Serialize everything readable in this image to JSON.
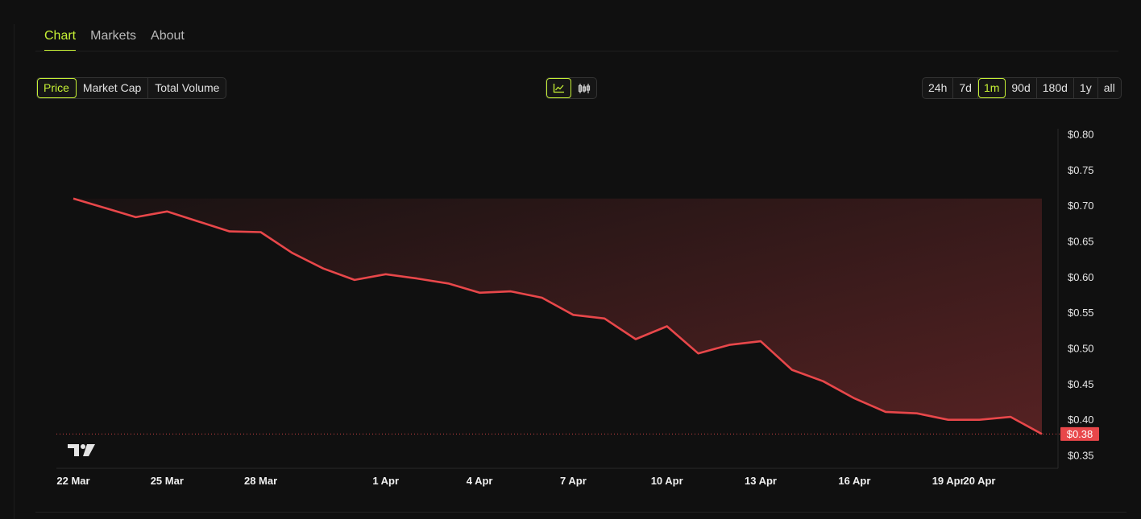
{
  "tabs": [
    {
      "label": "Chart",
      "active": true
    },
    {
      "label": "Markets",
      "active": false
    },
    {
      "label": "About",
      "active": false
    }
  ],
  "metric_options": [
    {
      "label": "Price",
      "active": true
    },
    {
      "label": "Market Cap",
      "active": false
    },
    {
      "label": "Total Volume",
      "active": false
    }
  ],
  "chart_type_options": [
    {
      "icon": "line-chart-icon",
      "active": true
    },
    {
      "icon": "candlestick-icon",
      "active": false
    }
  ],
  "range_options": [
    {
      "label": "24h",
      "active": false
    },
    {
      "label": "7d",
      "active": false
    },
    {
      "label": "1m",
      "active": true
    },
    {
      "label": "90d",
      "active": false
    },
    {
      "label": "180d",
      "active": false
    },
    {
      "label": "1y",
      "active": false
    },
    {
      "label": "all",
      "active": false
    }
  ],
  "colors": {
    "accent": "#c6f135",
    "line": "#e8474a",
    "price_tag_bg": "#e8474a"
  },
  "chart_data": {
    "type": "area",
    "x_ticks": [
      "22 Mar",
      "25 Mar",
      "28 Mar",
      "1 Apr",
      "4 Apr",
      "7 Apr",
      "10 Apr",
      "13 Apr",
      "16 Apr",
      "19 Apr",
      "20 Apr"
    ],
    "y_ticks": [
      "$0.80",
      "$0.75",
      "$0.70",
      "$0.65",
      "$0.60",
      "$0.55",
      "$0.50",
      "$0.45",
      "$0.40",
      "$0.35"
    ],
    "ylim": [
      0.35,
      0.8
    ],
    "last_price_label": "$0.38",
    "last_price": 0.38,
    "grid": false,
    "series": [
      {
        "points": [
          [
            "2024-03-22",
            0.71
          ],
          [
            "2024-03-23",
            0.697
          ],
          [
            "2024-03-24",
            0.684
          ],
          [
            "2024-03-25",
            0.692
          ],
          [
            "2024-03-26",
            0.678
          ],
          [
            "2024-03-27",
            0.664
          ],
          [
            "2024-03-28",
            0.663
          ],
          [
            "2024-03-29",
            0.634
          ],
          [
            "2024-03-30",
            0.612
          ],
          [
            "2024-03-31",
            0.596
          ],
          [
            "2024-04-01",
            0.604
          ],
          [
            "2024-04-02",
            0.598
          ],
          [
            "2024-04-03",
            0.591
          ],
          [
            "2024-04-04",
            0.578
          ],
          [
            "2024-04-05",
            0.58
          ],
          [
            "2024-04-06",
            0.571
          ],
          [
            "2024-04-07",
            0.547
          ],
          [
            "2024-04-08",
            0.542
          ],
          [
            "2024-04-09",
            0.513
          ],
          [
            "2024-04-10",
            0.531
          ],
          [
            "2024-04-11",
            0.493
          ],
          [
            "2024-04-12",
            0.505
          ],
          [
            "2024-04-13",
            0.51
          ],
          [
            "2024-04-14",
            0.47
          ],
          [
            "2024-04-15",
            0.454
          ],
          [
            "2024-04-16",
            0.43
          ],
          [
            "2024-04-17",
            0.411
          ],
          [
            "2024-04-18",
            0.409
          ],
          [
            "2024-04-19",
            0.4
          ],
          [
            "2024-04-20",
            0.4
          ],
          [
            "2024-04-21",
            0.404
          ],
          [
            "2024-04-22",
            0.38
          ]
        ]
      }
    ]
  }
}
